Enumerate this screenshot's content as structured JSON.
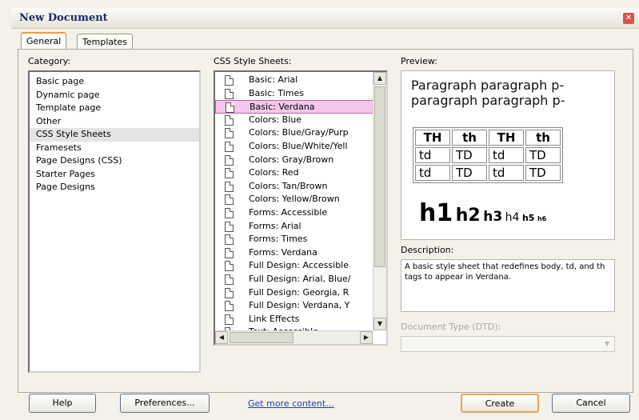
{
  "window": {
    "title": "New Document"
  },
  "tabs": [
    {
      "label": "General",
      "active": true
    },
    {
      "label": "Templates",
      "active": false
    }
  ],
  "category": {
    "label": "Category:",
    "items": [
      "Basic page",
      "Dynamic page",
      "Template page",
      "Other",
      "CSS Style Sheets",
      "Framesets",
      "Page Designs (CSS)",
      "Starter Pages",
      "Page Designs"
    ],
    "selected": "CSS Style Sheets"
  },
  "css": {
    "label": "CSS Style Sheets:",
    "items": [
      "Basic: Arial",
      "Basic: Times",
      "Basic: Verdana",
      "Colors: Blue",
      "Colors: Blue/Gray/Purp",
      "Colors: Blue/White/Yell",
      "Colors: Gray/Brown",
      "Colors: Red",
      "Colors: Tan/Brown",
      "Colors: Yellow/Brown",
      "Forms: Accessible",
      "Forms: Arial",
      "Forms: Times",
      "Forms: Verdana",
      "Full Design: Accessible",
      "Full Design: Arial, Blue/",
      "Full Design: Georgia, R",
      "Full Design: Verdana, Y",
      "Link Effects",
      "Text: Accessible"
    ],
    "selected": "Basic: Verdana"
  },
  "preview": {
    "label": "Preview:",
    "paragraph_line1": "Paragraph paragraph p-",
    "paragraph_line2": "paragraph paragraph p-",
    "table": [
      [
        "TH",
        "th",
        "TH",
        "th"
      ],
      [
        "td",
        "TD",
        "td",
        "TD"
      ],
      [
        "td",
        "TD",
        "td",
        "TD"
      ]
    ],
    "headings": [
      "h1",
      "h2",
      "h3",
      "h4",
      "h5",
      "h6"
    ]
  },
  "description": {
    "label": "Description:",
    "text": "A basic style sheet that redefines body, td, and th tags to appear in Verdana."
  },
  "doctype": {
    "label": "Document Type (DTD):",
    "value": ""
  },
  "buttons": {
    "help": "Help",
    "preferences": "Preferences...",
    "get_more": "Get more content...",
    "create": "Create",
    "cancel": "Cancel"
  },
  "colors": {
    "selection_pink": "#f4c6ec",
    "link_blue": "#1f3fbf",
    "default_button_border": "#e2a55a"
  }
}
